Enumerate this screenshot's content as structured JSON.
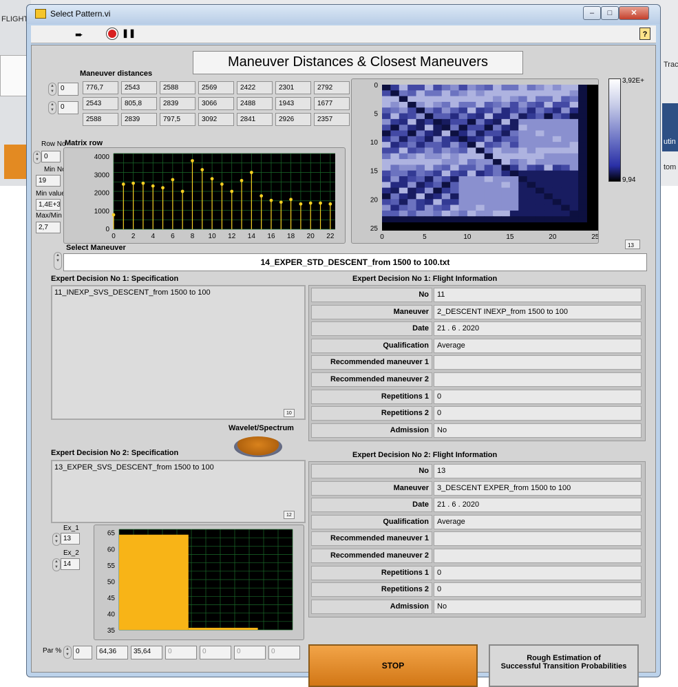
{
  "bg": {
    "left_label": "FLIGHT",
    "right_labels": [
      "Trac",
      "utin",
      "tom"
    ]
  },
  "window": {
    "title": "Select Pattern.vi",
    "help_icon": "?"
  },
  "heading": "Maneuver Distances & Closest Maneuvers",
  "maneuver_distances": {
    "label": "Maneuver distances",
    "row_index": "0",
    "col_index": "0",
    "rows": [
      [
        "776,7",
        "2543",
        "2588",
        "2569",
        "2422",
        "2301",
        "2792"
      ],
      [
        "2543",
        "805,8",
        "2839",
        "3066",
        "2488",
        "1943",
        "1677"
      ],
      [
        "2588",
        "2839",
        "797,5",
        "3092",
        "2841",
        "2926",
        "2357"
      ]
    ]
  },
  "row_no": {
    "label": "Row No",
    "value": "0"
  },
  "min_no": {
    "label": "Min No",
    "value": "19"
  },
  "min_value": {
    "label": "Min value",
    "value": "1,4E+3"
  },
  "max_min": {
    "label": "Max/Min",
    "value": "2,7"
  },
  "matrix_row": {
    "label": "Matrix row",
    "y_ticks": [
      "4000",
      "3000",
      "2000",
      "1000",
      "0"
    ],
    "x_ticks": [
      "0",
      "2",
      "4",
      "6",
      "8",
      "10",
      "12",
      "14",
      "16",
      "18",
      "20",
      "22"
    ]
  },
  "heatmap": {
    "y_ticks": [
      "0",
      "5",
      "10",
      "15",
      "20",
      "25"
    ],
    "x_ticks": [
      "0",
      "5",
      "10",
      "15",
      "20",
      "25"
    ],
    "scale_max": "3,92E+",
    "scale_min": "9,94",
    "index": "13"
  },
  "select_maneuver": {
    "label": "Select Maneuver",
    "value": "14_EXPER_STD_DESCENT_from 1500 to 100.txt"
  },
  "expert1": {
    "spec_label": "Expert Decision No 1: Specification",
    "spec_text": "11_INEXP_SVS_DESCENT_from 1500 to 100",
    "spec_index": "10",
    "info_label": "Expert Decision No 1: Flight Information",
    "info": [
      {
        "label": "No",
        "value": "11"
      },
      {
        "label": "Maneuver",
        "value": "2_DESCENT INEXP_from 1500 to 100"
      },
      {
        "label": "Date",
        "value": "21 . 6 . 2020"
      },
      {
        "label": "Qualification",
        "value": "Average"
      },
      {
        "label": "Recommended maneuver 1",
        "value": ""
      },
      {
        "label": "Recommended maneuver 2",
        "value": ""
      },
      {
        "label": "Repetitions 1",
        "value": "0"
      },
      {
        "label": "Repetitions 2",
        "value": "0"
      },
      {
        "label": "Admission",
        "value": "No"
      }
    ]
  },
  "wavelet_label": "Wavelet/Spectrum",
  "expert2": {
    "spec_label": "Expert Decision No 2: Specification",
    "spec_text": "13_EXPER_SVS_DESCENT_from 1500 to 100",
    "spec_index": "12",
    "info_label": "Expert Decision No 2: Flight Information",
    "info": [
      {
        "label": "No",
        "value": "13"
      },
      {
        "label": "Maneuver",
        "value": "3_DESCENT EXPER_from 1500 to 100"
      },
      {
        "label": "Date",
        "value": "21 . 6 . 2020"
      },
      {
        "label": "Qualification",
        "value": "Average"
      },
      {
        "label": "Recommended maneuver 1",
        "value": ""
      },
      {
        "label": "Recommended maneuver 2",
        "value": ""
      },
      {
        "label": "Repetitions 1",
        "value": "0"
      },
      {
        "label": "Repetitions 2",
        "value": "0"
      },
      {
        "label": "Admission",
        "value": "No"
      }
    ]
  },
  "ex1": {
    "label": "Ex_1",
    "value": "13"
  },
  "ex2": {
    "label": "Ex_2",
    "value": "14"
  },
  "bar_chart": {
    "y_ticks": [
      "65",
      "60",
      "55",
      "50",
      "45",
      "40",
      "35"
    ]
  },
  "par": {
    "label": "Par %",
    "value": "0",
    "values": [
      "64,36",
      "35,64",
      "0",
      "0",
      "0",
      "0"
    ]
  },
  "buttons": {
    "stop": "STOP",
    "rough_line1": "Rough Estimation of",
    "rough_line2": "Successful Transition Probabilities"
  },
  "chart_data": [
    {
      "type": "scatter",
      "title": "Matrix row",
      "x": [
        0,
        1,
        2,
        3,
        4,
        5,
        6,
        7,
        8,
        9,
        10,
        11,
        12,
        13,
        14,
        15,
        16,
        17,
        18,
        19,
        20,
        21,
        22
      ],
      "y": [
        800,
        2500,
        2550,
        2550,
        2400,
        2300,
        2750,
        2100,
        3800,
        3300,
        2800,
        2500,
        2100,
        2700,
        3150,
        1850,
        1600,
        1500,
        1650,
        1400,
        1450,
        1450,
        1400
      ],
      "xlim": [
        0,
        22.5
      ],
      "ylim": [
        0,
        4200
      ]
    },
    {
      "type": "bar",
      "categories": [
        "Ex_1",
        "Ex_2"
      ],
      "values": [
        64.36,
        35.64
      ],
      "ylim": [
        35,
        66
      ]
    }
  ]
}
